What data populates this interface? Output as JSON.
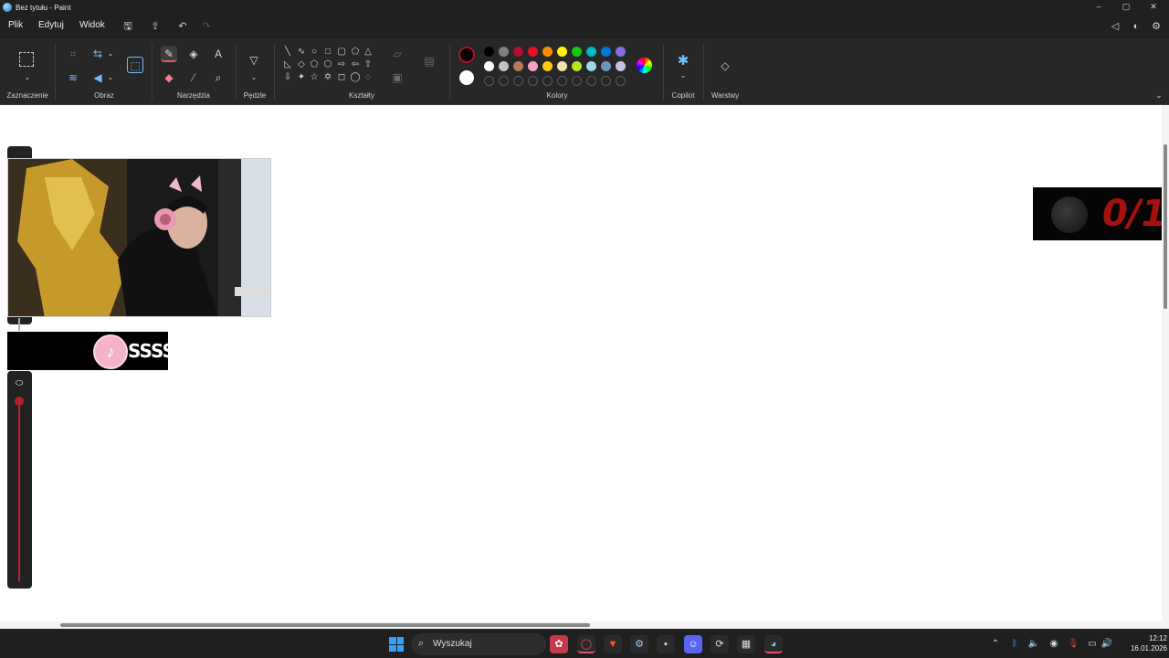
{
  "window": {
    "title": "Bez tytułu - Paint",
    "minimize": "–",
    "maximize": "▢",
    "close": "✕"
  },
  "menu": {
    "file": "Plik",
    "edit": "Edytuj",
    "view": "Widok"
  },
  "ribbon": {
    "groups": {
      "selection": "Zaznaczenie",
      "image": "Obraz",
      "tools": "Narzędzia",
      "brushes": "Pędzle",
      "shapes": "Kształty",
      "colors": "Kolory",
      "copilot": "Copilot",
      "layers": "Warstwy"
    },
    "palette_row1": [
      "#000000",
      "#7f7f7f",
      "#b10f2e",
      "#e81123",
      "#ff8c00",
      "#fff100",
      "#16c60c",
      "#00b7c3",
      "#0078d4",
      "#886ce4"
    ],
    "palette_row2": [
      "#ffffff",
      "#c3c3c3",
      "#b97a57",
      "#f7a1c4",
      "#ffc90e",
      "#efe4b0",
      "#b5e61d",
      "#99d9ea",
      "#7092be",
      "#c8bfe7"
    ],
    "primary_color": "#000000",
    "secondary_color": "#ffffff"
  },
  "canvas": {
    "tiktok_text": "SSSS",
    "counter_text": "0/1"
  },
  "taskbar": {
    "search_placeholder": "Wyszukaj",
    "time": "12:12",
    "date": "16.01.2026"
  }
}
